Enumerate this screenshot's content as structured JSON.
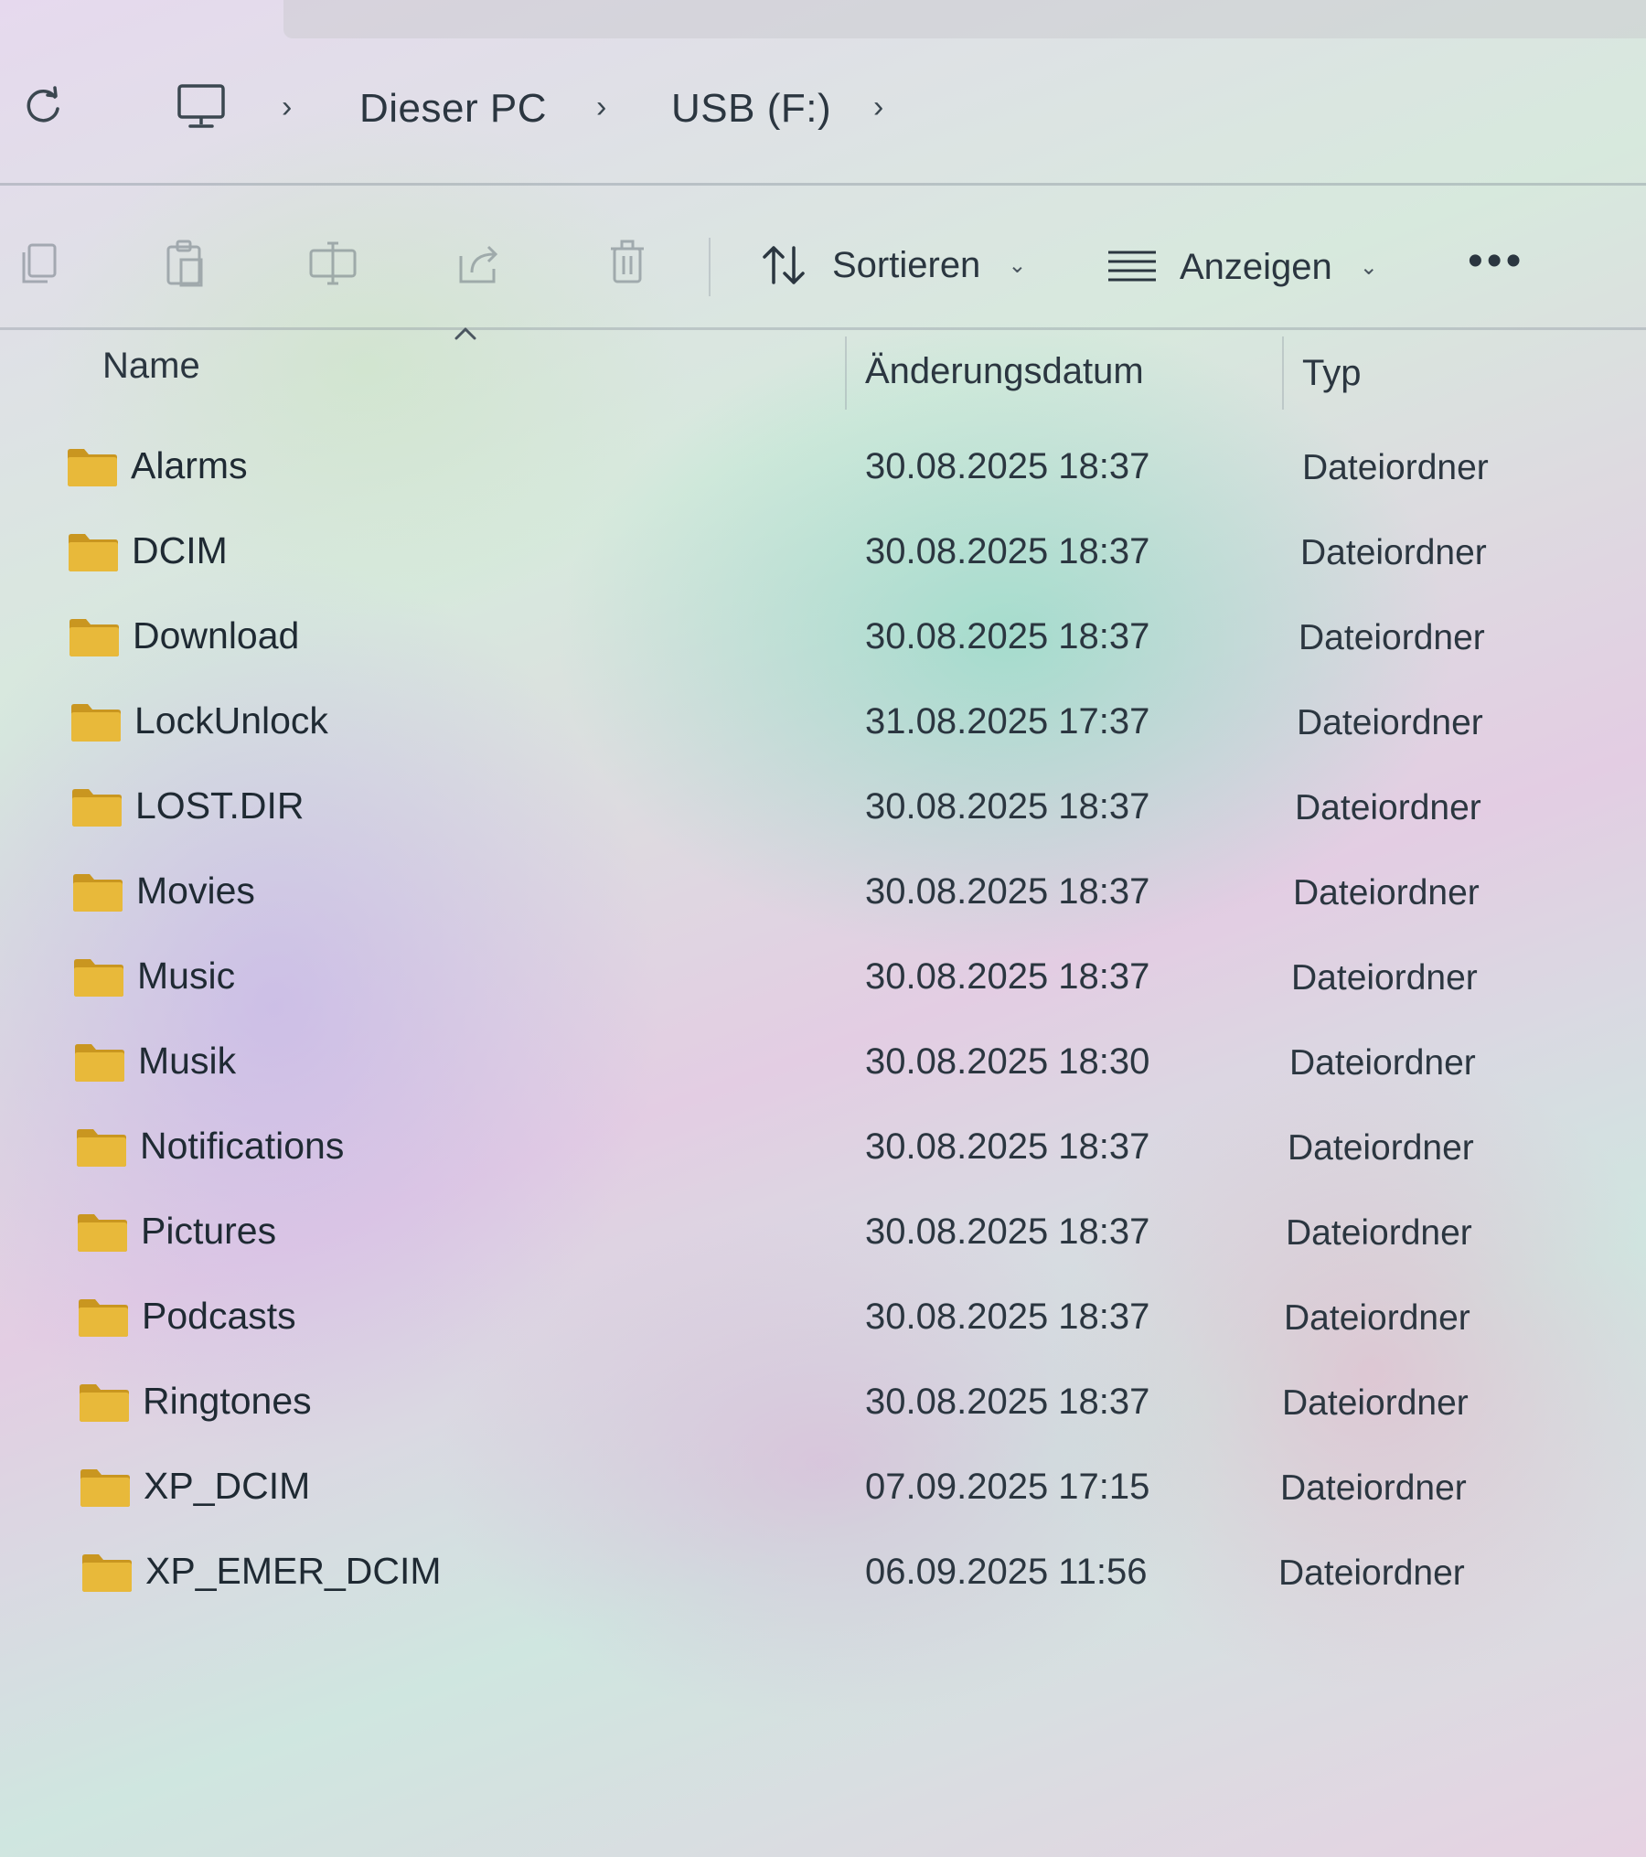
{
  "breadcrumb": {
    "items": [
      "Dieser PC",
      "USB (F:)"
    ]
  },
  "toolbar": {
    "sort_label": "Sortieren",
    "view_label": "Anzeigen",
    "more_label": "•••"
  },
  "columns": {
    "name": "Name",
    "date": "Änderungsdatum",
    "type": "Typ"
  },
  "files": [
    {
      "name": "Alarms",
      "date": "30.08.2025 18:37",
      "type": "Dateiordner"
    },
    {
      "name": "DCIM",
      "date": "30.08.2025 18:37",
      "type": "Dateiordner"
    },
    {
      "name": "Download",
      "date": "30.08.2025 18:37",
      "type": "Dateiordner"
    },
    {
      "name": "LockUnlock",
      "date": "31.08.2025 17:37",
      "type": "Dateiordner"
    },
    {
      "name": "LOST.DIR",
      "date": "30.08.2025 18:37",
      "type": "Dateiordner"
    },
    {
      "name": "Movies",
      "date": "30.08.2025 18:37",
      "type": "Dateiordner"
    },
    {
      "name": "Music",
      "date": "30.08.2025 18:37",
      "type": "Dateiordner"
    },
    {
      "name": "Musik",
      "date": "30.08.2025 18:30",
      "type": "Dateiordner"
    },
    {
      "name": "Notifications",
      "date": "30.08.2025 18:37",
      "type": "Dateiordner"
    },
    {
      "name": "Pictures",
      "date": "30.08.2025 18:37",
      "type": "Dateiordner"
    },
    {
      "name": "Podcasts",
      "date": "30.08.2025 18:37",
      "type": "Dateiordner"
    },
    {
      "name": "Ringtones",
      "date": "30.08.2025 18:37",
      "type": "Dateiordner"
    },
    {
      "name": "XP_DCIM",
      "date": "07.09.2025 17:15",
      "type": "Dateiordner"
    },
    {
      "name": "XP_EMER_DCIM",
      "date": "06.09.2025 11:56",
      "type": "Dateiordner"
    }
  ],
  "colors": {
    "folder": "#e8b93a",
    "folder_dark": "#c99620",
    "text": "#1f2a33"
  }
}
